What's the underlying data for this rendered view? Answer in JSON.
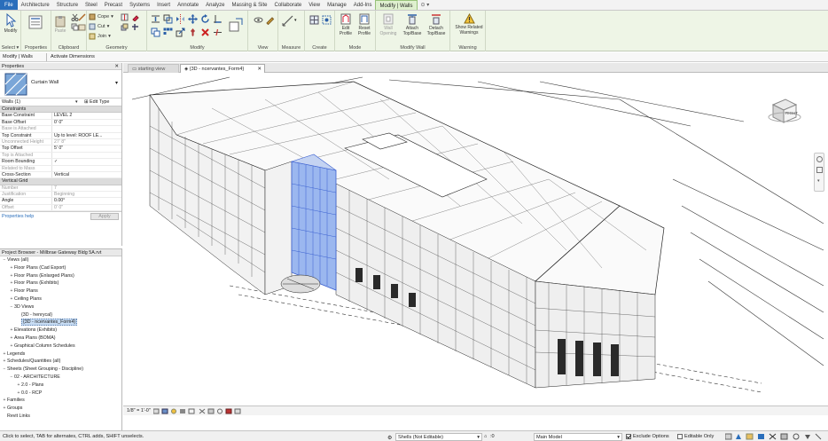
{
  "menu": {
    "tabs": [
      "File",
      "Architecture",
      "Structure",
      "Steel",
      "Precast",
      "Systems",
      "Insert",
      "Annotate",
      "Analyze",
      "Massing & Site",
      "Collaborate",
      "View",
      "Manage",
      "Add-Ins",
      "Modify | Walls"
    ],
    "file_tab": "File",
    "active_tab": "Modify | Walls"
  },
  "ribbon": {
    "select": {
      "label": "Select",
      "modify": "Modify"
    },
    "properties": {
      "label": "Properties"
    },
    "clipboard": {
      "label": "Clipboard",
      "paste": "Paste"
    },
    "geometry": {
      "label": "Geometry",
      "cope": "Cope",
      "cut": "Cut",
      "join": "Join"
    },
    "modify": {
      "label": "Modify"
    },
    "view": {
      "label": "View"
    },
    "measure": {
      "label": "Measure"
    },
    "create": {
      "label": "Create"
    },
    "mode": {
      "label": "Mode",
      "edit_profile": "Edit Profile",
      "reset_profile": "Reset Profile"
    },
    "modify_wall": {
      "label": "Modify Wall",
      "wall_opening": "Wall Opening",
      "attach": "Attach Top/Base",
      "detach": "Detach Top/Base"
    },
    "warning": {
      "label": "Warning",
      "show_related": "Show Related Warnings"
    }
  },
  "options_bar": {
    "context": "Modify | Walls",
    "activate_dimensions": "Activate Dimensions"
  },
  "properties": {
    "header": "Properties",
    "type_name": "Curtain Wall",
    "selector": "Walls (1)",
    "edit_type": "Edit Type",
    "groups": {
      "constraints": "Constraints",
      "vertical_grid": "Vertical Grid"
    },
    "rows": [
      {
        "k": "Base Constraint",
        "v": "LEVEL 2",
        "dim": false
      },
      {
        "k": "Base Offset",
        "v": "0'  0\"",
        "dim": false
      },
      {
        "k": "Base is Attached",
        "v": "",
        "dim": true
      },
      {
        "k": "Top Constraint",
        "v": "Up to level: ROOF LE...",
        "dim": false
      },
      {
        "k": "Unconnected Height",
        "v": "27'  8\"",
        "dim": true
      },
      {
        "k": "Top Offset",
        "v": "5'  0\"",
        "dim": false
      },
      {
        "k": "Top is Attached",
        "v": "",
        "dim": true
      },
      {
        "k": "Room Bounding",
        "v": "✓",
        "dim": false
      },
      {
        "k": "Related to Mass",
        "v": "",
        "dim": true
      },
      {
        "k": "Cross-Section",
        "v": "Vertical",
        "dim": false
      }
    ],
    "grid_rows": [
      {
        "k": "Number",
        "v": "7",
        "dim": true
      },
      {
        "k": "Justification",
        "v": "Beginning",
        "dim": true
      },
      {
        "k": "Angle",
        "v": "0.00°",
        "dim": false
      },
      {
        "k": "Offset",
        "v": "0'  0\"",
        "dim": true
      }
    ],
    "help": "Properties help",
    "apply": "Apply"
  },
  "browser": {
    "header": "Project Browser - Millbrae Gateway Bldg 5A.rvt",
    "nodes": [
      {
        "level": 0,
        "tw": "−",
        "label": "Views (all)"
      },
      {
        "level": 1,
        "tw": "+",
        "label": "Floor Plans (Cad Export)"
      },
      {
        "level": 1,
        "tw": "+",
        "label": "Floor Plans (Enlarged Plans)"
      },
      {
        "level": 1,
        "tw": "+",
        "label": "Floor Plans (Exhibits)"
      },
      {
        "level": 1,
        "tw": "+",
        "label": "Floor Plans"
      },
      {
        "level": 1,
        "tw": "+",
        "label": "Ceiling Plans"
      },
      {
        "level": 1,
        "tw": "−",
        "label": "3D Views"
      },
      {
        "level": 2,
        "tw": "",
        "label": "{3D - henrycal}"
      },
      {
        "level": 2,
        "tw": "",
        "label": "{3D - ncervantes_Form4}",
        "selected": true
      },
      {
        "level": 1,
        "tw": "+",
        "label": "Elevations (Exhibits)"
      },
      {
        "level": 1,
        "tw": "+",
        "label": "Area Plans (BOMA)"
      },
      {
        "level": 1,
        "tw": "+",
        "label": "Graphical Column Schedules"
      },
      {
        "level": 0,
        "tw": "+",
        "label": "Legends"
      },
      {
        "level": 0,
        "tw": "+",
        "label": "Schedules/Quantities (all)"
      },
      {
        "level": 0,
        "tw": "−",
        "label": "Sheets (Sheet Grouping - Discipline)"
      },
      {
        "level": 1,
        "tw": "−",
        "label": "02 - ARCHITECTURE"
      },
      {
        "level": 2,
        "tw": "+",
        "label": "2.0 - Plans"
      },
      {
        "level": 2,
        "tw": "+",
        "label": "0.0 - RCP"
      },
      {
        "level": 0,
        "tw": "+",
        "label": "Families"
      },
      {
        "level": 0,
        "tw": "+",
        "label": "Groups"
      },
      {
        "level": 0,
        "tw": "",
        "label": "Revit Links"
      }
    ]
  },
  "view_tabs": [
    {
      "label": "starting view",
      "active": false
    },
    {
      "label": "{3D - ncervantes_Form4}",
      "active": true
    }
  ],
  "view_control": {
    "scale": "1/8\" = 1'-0\""
  },
  "view_cube": {
    "face": "RIGHT"
  },
  "status": {
    "hint": "Click to select, TAB for alternates, CTRL adds, SHIFT unselects.",
    "workset": "Shells (Not Editable)",
    "zero": ":0",
    "model": "Main Model",
    "exclude_options": "Exclude Options",
    "editable_only": "Editable Only"
  },
  "colors": {
    "ribbon_bg": "#eef5e6",
    "file_tab": "#2a6ebb",
    "selection_blue": "#4f7fe0",
    "accent_green": "#98c37a"
  }
}
